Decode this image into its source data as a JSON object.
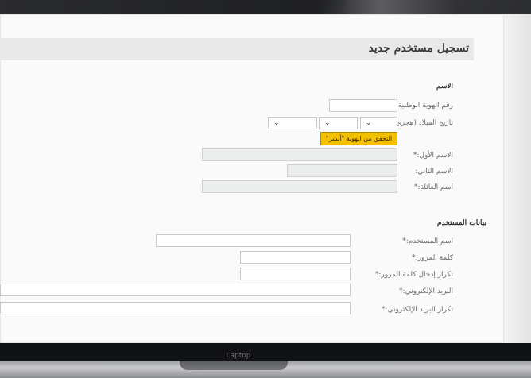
{
  "device": {
    "brand": "Laptop"
  },
  "page": {
    "title": "تسجيل مستخدم جديد"
  },
  "name_section": {
    "title": "الاسم",
    "national_id_label": "رقم الهوية الوطنية:*",
    "national_id_value": "",
    "birth_date_label": "تاريخ الميلاد (هجري):*",
    "verify_button": "التحقق من الهوية \"أبشر\"",
    "first_name_label": "الاسم الأول:*",
    "first_name_value": "",
    "second_name_label": "الاسم الثاني:",
    "second_name_value": "",
    "family_name_label": "اسم العائلة:*",
    "family_name_value": ""
  },
  "user_section": {
    "title": "بيانات المستخدم",
    "username_label": "اسم المستخدم:*",
    "username_value": "",
    "password_label": "كلمة المرور:*",
    "password_confirm_label": "تكرار إدخال كلمة المرور:*",
    "email_label": "البريد الإلكتروني:*",
    "email_value": "",
    "email_confirm_label": "تكرار البريد الإلكتروني:*",
    "email_confirm_value": ""
  },
  "colors": {
    "verify_button": "#f3c000",
    "required_marker": "#2a63c7"
  }
}
